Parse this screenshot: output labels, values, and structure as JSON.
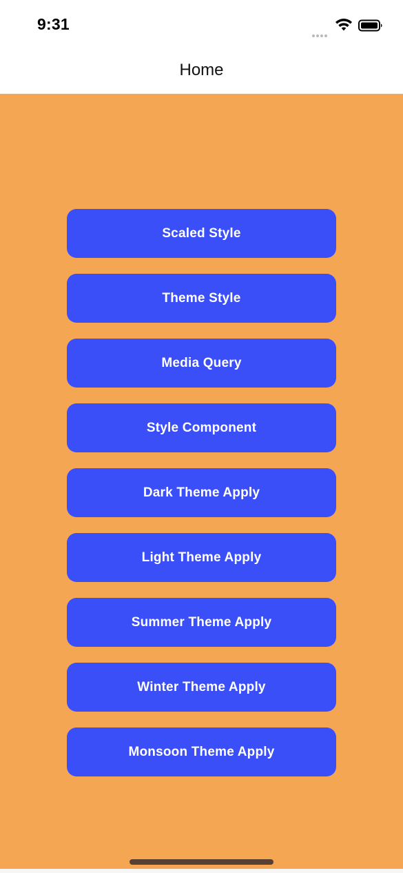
{
  "status_bar": {
    "time": "9:31"
  },
  "nav": {
    "title": "Home"
  },
  "buttons": [
    {
      "label": "Scaled Style"
    },
    {
      "label": "Theme Style"
    },
    {
      "label": "Media Query"
    },
    {
      "label": "Style Component"
    },
    {
      "label": "Dark Theme Apply"
    },
    {
      "label": "Light Theme Apply"
    },
    {
      "label": "Summer Theme Apply"
    },
    {
      "label": "Winter Theme Apply"
    },
    {
      "label": "Monsoon Theme Apply"
    }
  ],
  "icons": {
    "signal": "signal-dots-icon",
    "wifi": "wifi-icon",
    "battery": "battery-icon"
  },
  "colors": {
    "background": "#f5a652",
    "button": "#3a4ff7",
    "button_text": "#ffffff",
    "header": "#ffffff"
  }
}
